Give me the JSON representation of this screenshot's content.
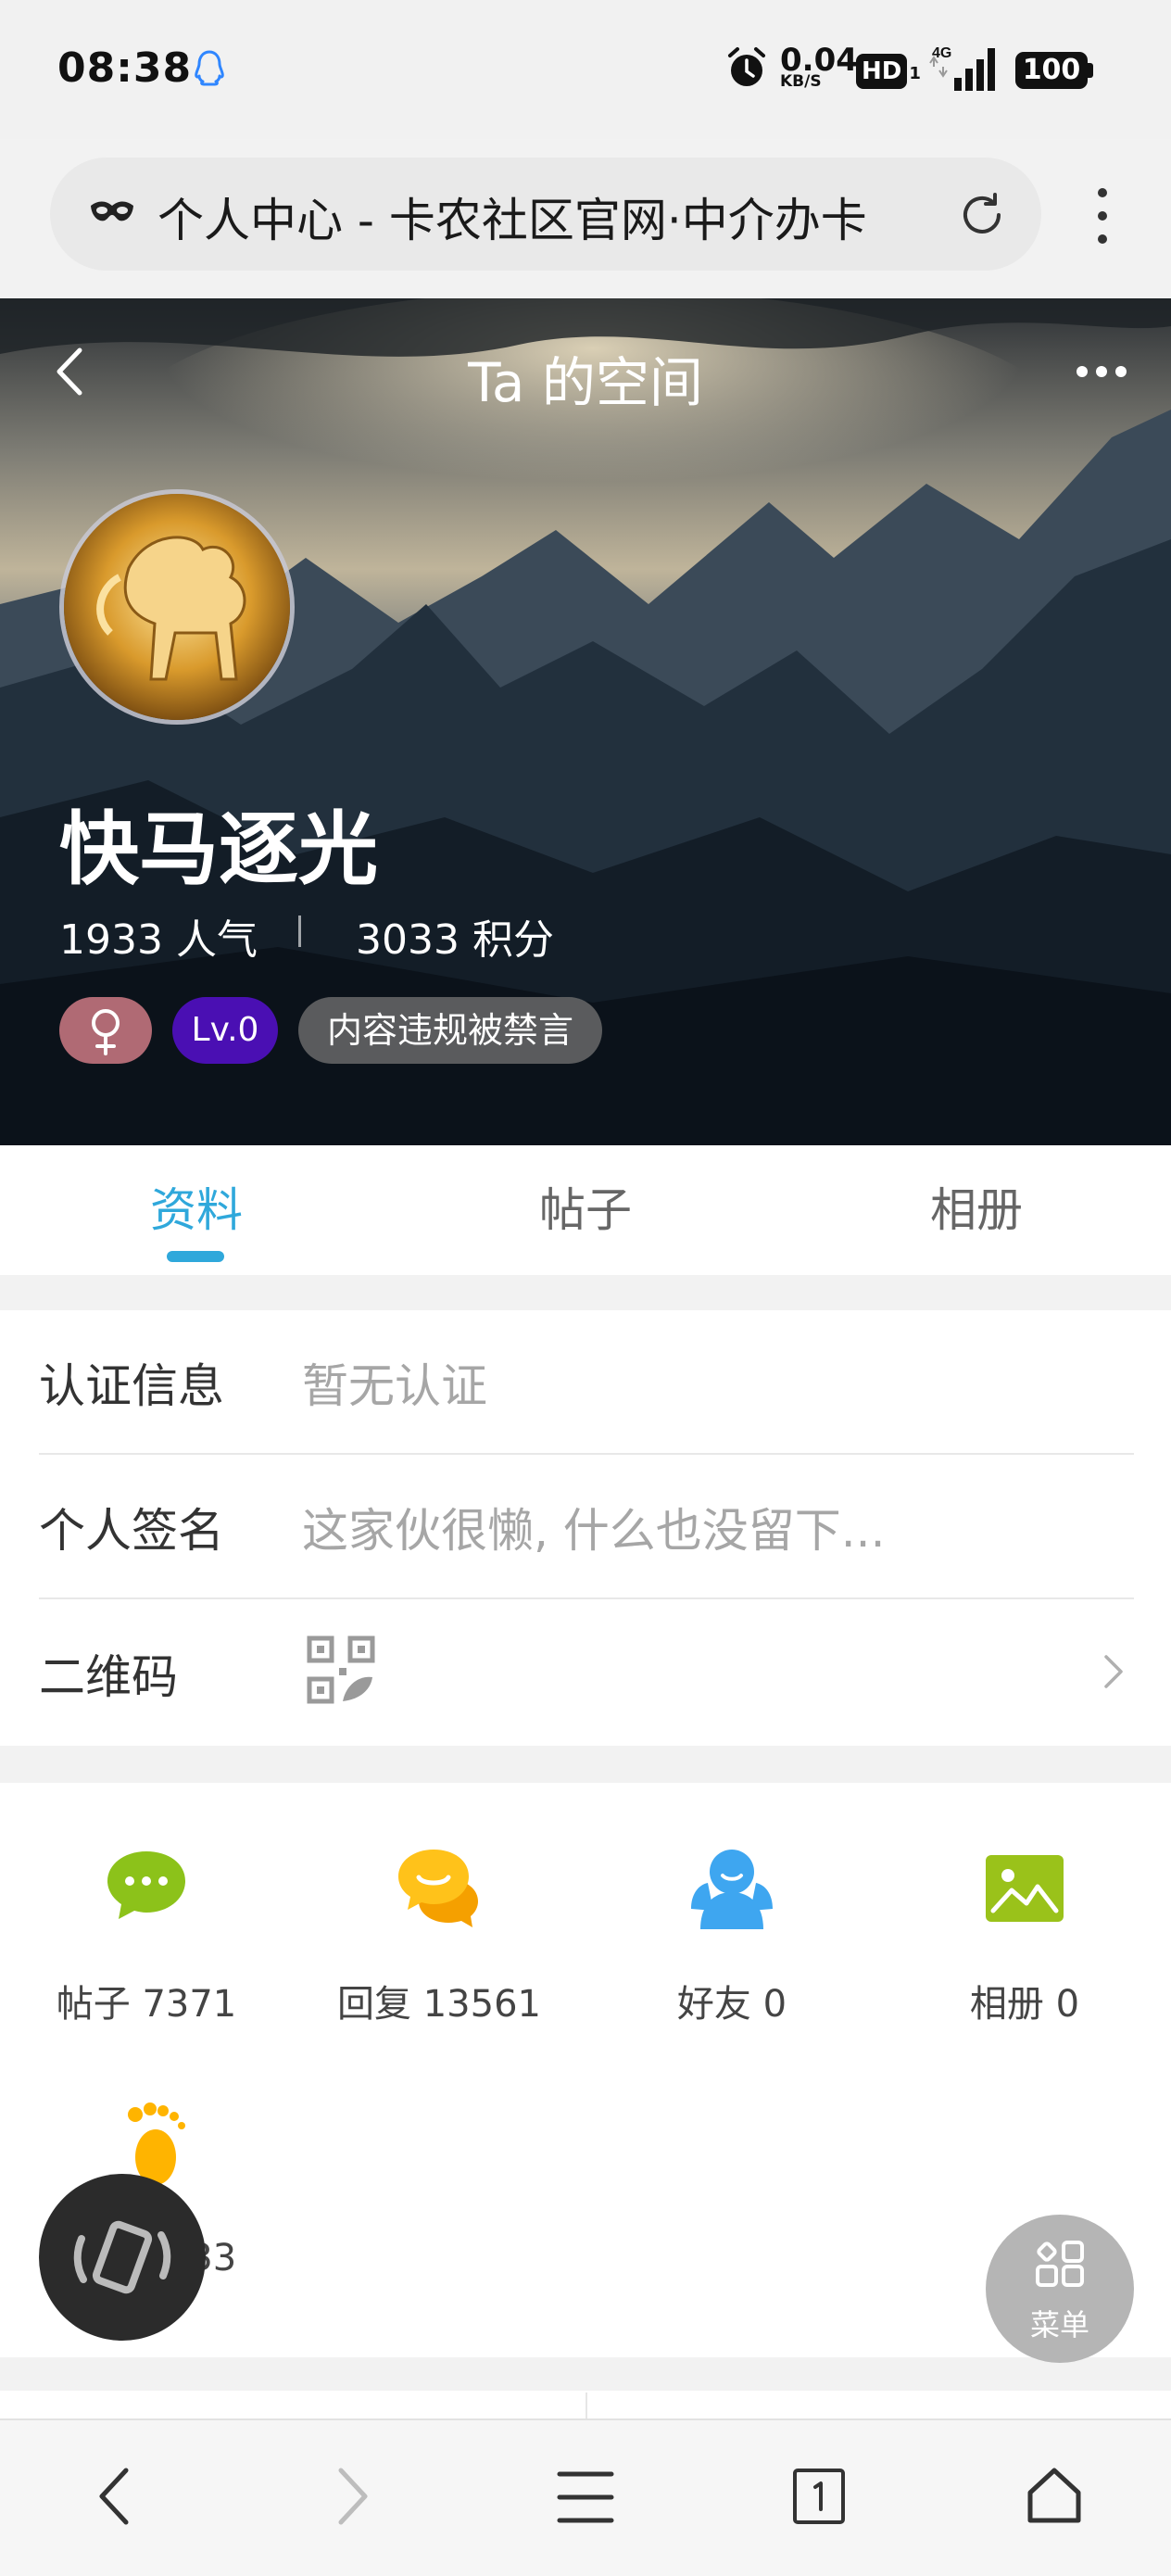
{
  "status_bar": {
    "time": "08:38",
    "net_speed": "0.04",
    "net_speed_unit": "KB/S",
    "hd_label": "HD",
    "hd_sub": "1",
    "network": "4G",
    "battery": "100"
  },
  "browser": {
    "address_text": "个人中心 - 卡农社区官网·中介办卡"
  },
  "hero": {
    "title": "Ta 的空间",
    "username": "快马逐光",
    "popularity": "1933 人气",
    "score": "3033 积分",
    "level_badge": "Lv.0",
    "ban_badge": "内容违规被禁言",
    "colors": {
      "gender_badge": "#b06a74",
      "level_badge": "#4a0fb3"
    }
  },
  "tabs": [
    {
      "label": "资料",
      "active": true
    },
    {
      "label": "帖子",
      "active": false
    },
    {
      "label": "相册",
      "active": false
    }
  ],
  "info": {
    "cert_label": "认证信息",
    "cert_value": "暂无认证",
    "sign_label": "个人签名",
    "sign_value": "这家伙很懒, 什么也没留下...",
    "qr_label": "二维码"
  },
  "stats": [
    {
      "label": "帖子 7371",
      "icon": "chat-bubble-icon"
    },
    {
      "label": "回复 13561",
      "icon": "reply-bubbles-icon"
    },
    {
      "label": "好友 0",
      "icon": "friends-icon"
    },
    {
      "label": "相册 0",
      "icon": "album-icon"
    },
    {
      "label": "足迹 1933",
      "icon": "footprint-icon"
    }
  ],
  "floating": {
    "menu_label": "菜单"
  },
  "accent_color": "#2fa8db"
}
